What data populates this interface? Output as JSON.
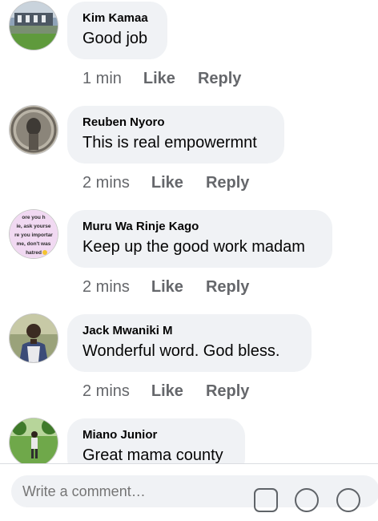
{
  "comments": [
    {
      "author": "Kim Kamaa",
      "text": "Good job",
      "time": "1 min",
      "like": "Like",
      "reply": "Reply"
    },
    {
      "author": "Reuben Nyoro",
      "text": "This is real empowermnt",
      "time": "2 mins",
      "like": "Like",
      "reply": "Reply"
    },
    {
      "author": "Muru Wa Rinje Kago",
      "text": "Keep up the good work madam",
      "time": "2 mins",
      "like": "Like",
      "reply": "Reply"
    },
    {
      "author": "Jack Mwaniki M",
      "text": "Wonderful word. God bless.",
      "time": "2 mins",
      "like": "Like",
      "reply": "Reply"
    },
    {
      "author": "Miano Junior",
      "text": "Great mama county"
    }
  ],
  "composer": {
    "placeholder": "Write a comment…"
  },
  "icons": {
    "sticker": "sticker-icon",
    "emoji": "emoji-icon",
    "gif": "gif-icon"
  },
  "avatar_meme_text": [
    "ore you h",
    "ie, ask yourse",
    "re you importar",
    "me, don't was",
    "hatred"
  ],
  "colors": {
    "bubble": "#f0f2f5",
    "meta_text": "#65676b",
    "name_text": "#050505"
  }
}
